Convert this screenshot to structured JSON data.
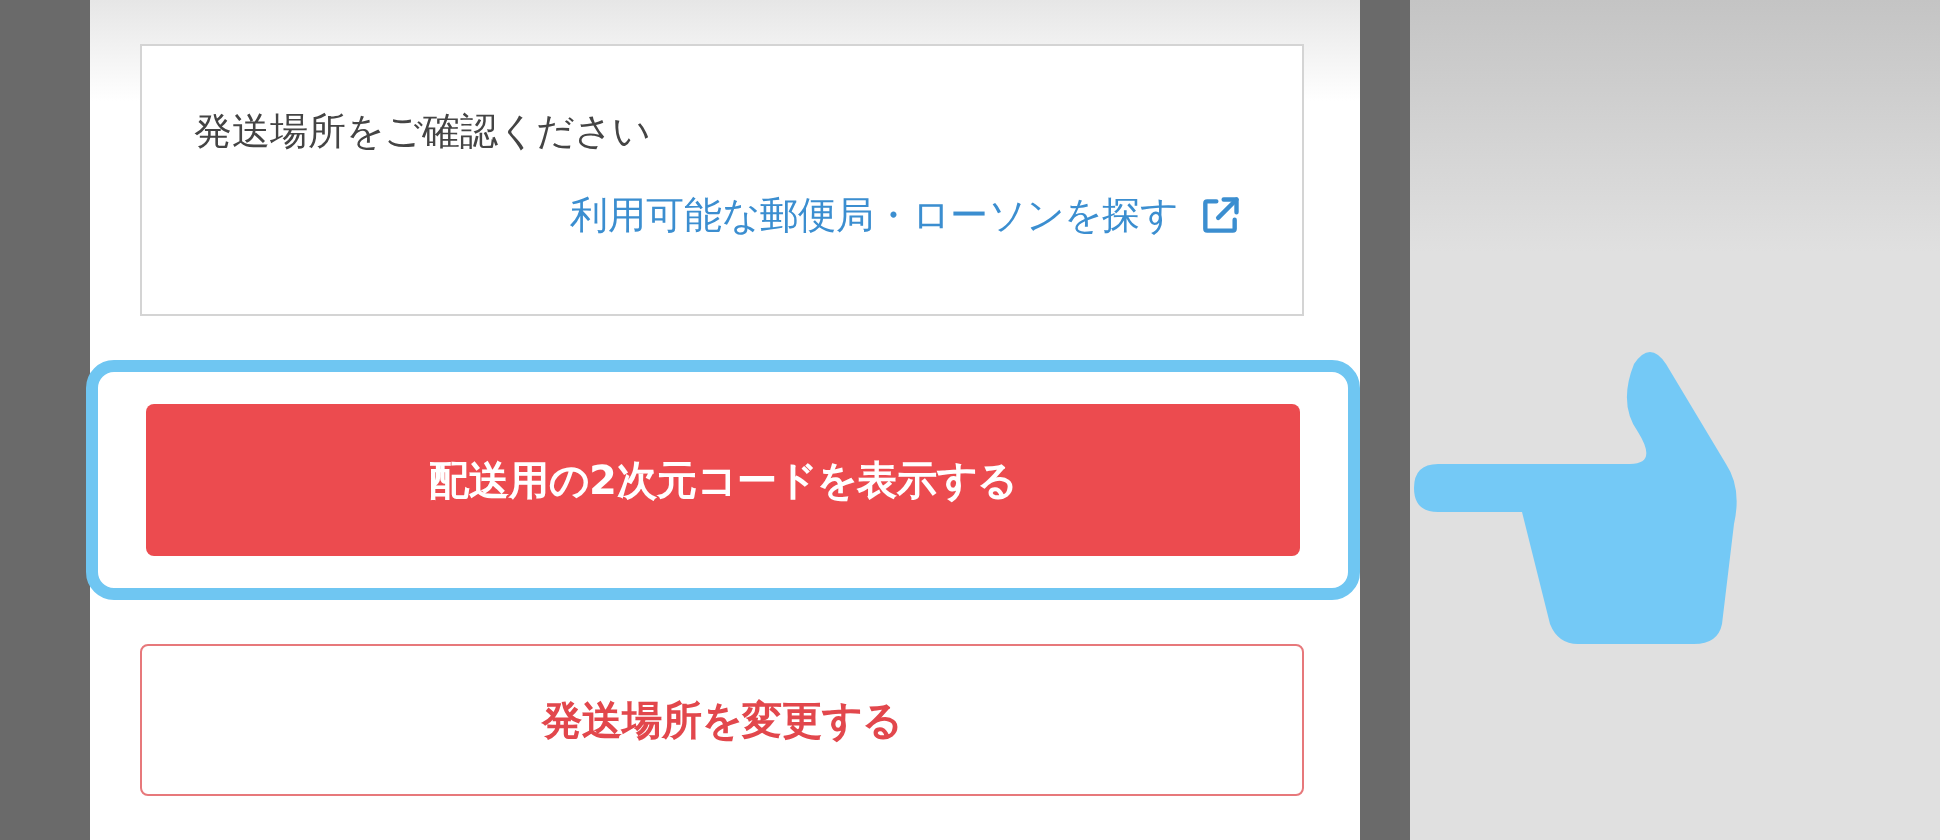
{
  "shipping_card": {
    "title": "発送場所をご確認ください",
    "link": "利用可能な郵便局・ローソンを探す"
  },
  "buttons": [
    {
      "kind": "primary",
      "label": "配送用の2次元コードを表示する",
      "highlighted": true
    },
    {
      "kind": "secondary",
      "label": "発送場所を変更する",
      "highlighted": false
    }
  ]
}
